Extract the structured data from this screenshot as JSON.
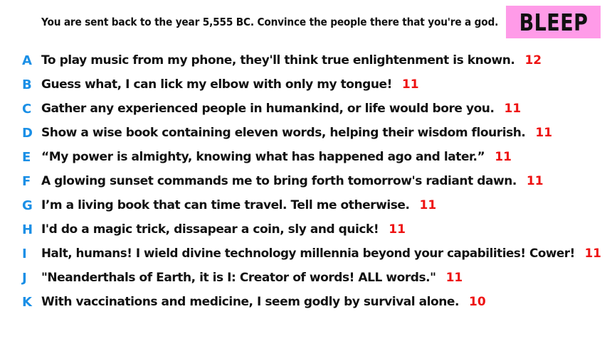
{
  "prompt": "You are sent back to the year 5,555 BC. Convince the people there that you're a god.",
  "badge": {
    "label": "BLEEP",
    "color": "#ff9be8"
  },
  "colors": {
    "letter": "#1a8fe6",
    "score": "#ee1111",
    "text": "#111111"
  },
  "answers": [
    {
      "letter": "A",
      "text": "To play music from my phone, they'll think true enlightenment is known.",
      "score": "12"
    },
    {
      "letter": "B",
      "text": "Guess what, I can lick my elbow with only my tongue!",
      "score": "11"
    },
    {
      "letter": "C",
      "text": "Gather any experienced people in humankind, or life would bore you.",
      "score": "11"
    },
    {
      "letter": "D",
      "text": "Show a wise book containing eleven words, helping their wisdom flourish.",
      "score": "11"
    },
    {
      "letter": "E",
      "text": "“My power is almighty, knowing what has happened ago and later.”",
      "score": "11"
    },
    {
      "letter": "F",
      "text": "A glowing sunset commands me to bring forth tomorrow's radiant dawn.",
      "score": "11"
    },
    {
      "letter": "G",
      "text": "I’m a living book that can time travel. Tell me otherwise.",
      "score": "11"
    },
    {
      "letter": "H",
      "text": "I'd do a magic trick, dissapear a coin, sly and quick!",
      "score": "11"
    },
    {
      "letter": "I",
      "text": "Halt, humans! I wield divine technology millennia beyond your capabilities! Cower!",
      "score": "11"
    },
    {
      "letter": "J",
      "text": "\"Neanderthals of Earth, it is I: Creator of words! ALL words.\"",
      "score": "11"
    },
    {
      "letter": "K",
      "text": "With vaccinations and medicine, I seem godly by survival alone.",
      "score": "10"
    }
  ]
}
